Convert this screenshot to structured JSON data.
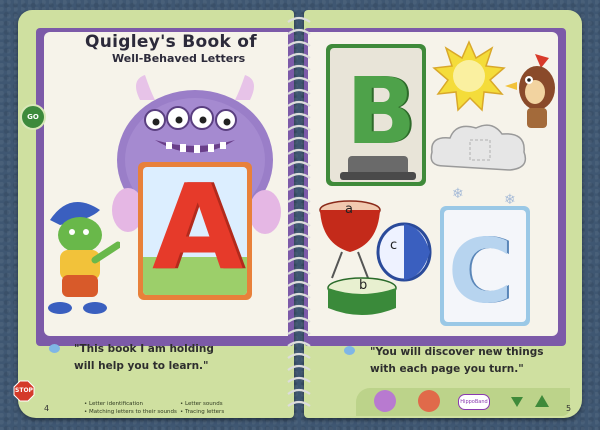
{
  "left_page": {
    "title_line1": "Quigley's Book of",
    "title_line2": "Well-Behaved Letters",
    "go_label": "GO",
    "stop_label": "STOP",
    "quote": "\"This book I am holding\nwill help you to learn.\"",
    "page_number": "4",
    "footer_col1": "• Letter identification\n• Matching letters to their sounds",
    "footer_col2": "• Letter sounds\n• Tracing letters",
    "big_letter": "A"
  },
  "right_page": {
    "quote": "\"You will discover new things\nwith each page you turn.\"",
    "page_number": "5",
    "big_letter_b": "B",
    "big_letter_c": "C",
    "drum_label_a": "a",
    "drum_label_b": "b",
    "drum_label_c": "c",
    "logo_text": "HippoBand"
  },
  "colors": {
    "page_green": "#cfe0a0",
    "book_purple": "#7c5aa8",
    "paper": "#f6f3ea",
    "frame_orange": "#e8803a",
    "frame_green": "#3f8a3a"
  }
}
